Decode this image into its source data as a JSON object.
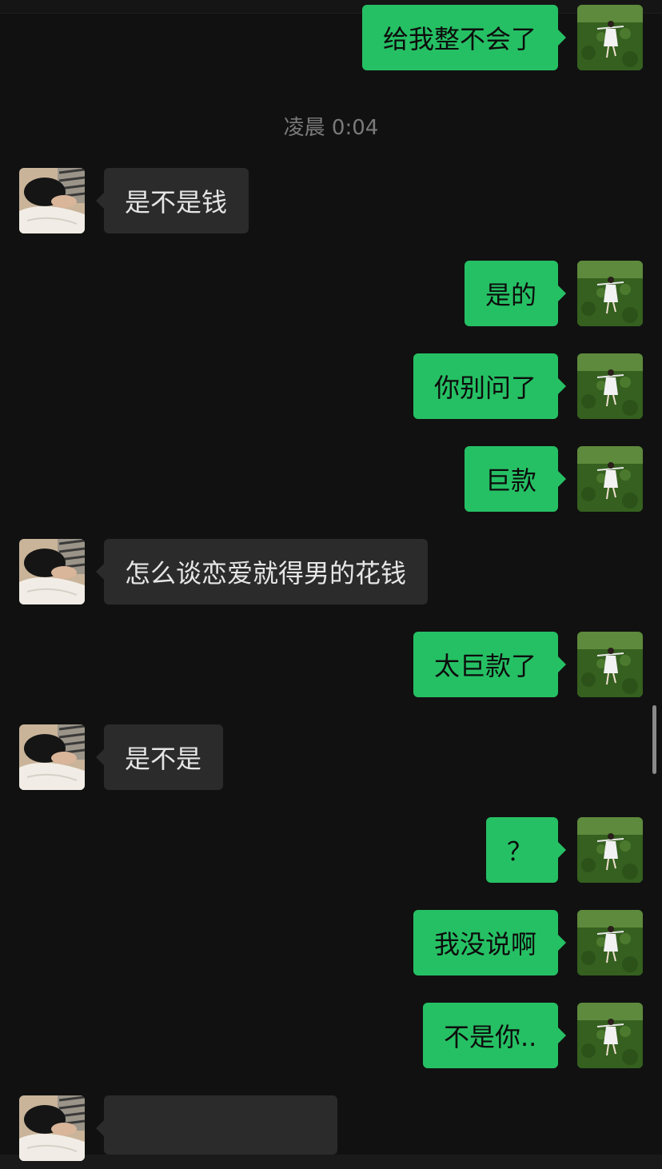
{
  "timestamp": "凌晨 0:04",
  "messages": [
    {
      "side": "sent",
      "text": "给我整不会了"
    },
    {
      "side": "recv",
      "text": "是不是钱"
    },
    {
      "side": "sent",
      "text": "是的"
    },
    {
      "side": "sent",
      "text": "你别问了"
    },
    {
      "side": "sent",
      "text": "巨款"
    },
    {
      "side": "recv",
      "text": "怎么谈恋爱就得男的花钱"
    },
    {
      "side": "sent",
      "text": "太巨款了"
    },
    {
      "side": "recv",
      "text": "是不是"
    },
    {
      "side": "sent",
      "text": "？"
    },
    {
      "side": "sent",
      "text": "我没说啊"
    },
    {
      "side": "sent",
      "text": "不是你.."
    },
    {
      "side": "recv",
      "text": ""
    }
  ],
  "icons": {
    "self_avatar": "girl-in-field-avatar-icon",
    "contact_avatar": "sleeping-person-avatar-icon"
  },
  "colors": {
    "background": "#111111",
    "sent_bubble": "#26c064",
    "recv_bubble": "#2b2b2b",
    "timestamp_text": "#7a7a7a"
  }
}
